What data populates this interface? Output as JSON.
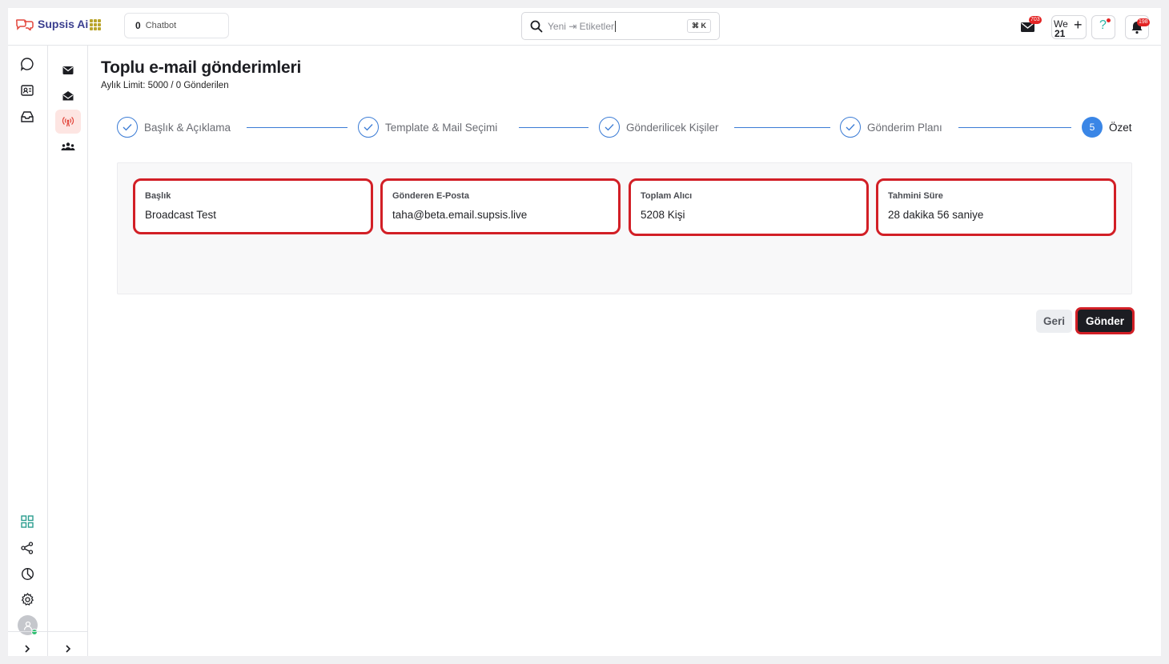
{
  "app": {
    "brand": "Supsis Ai"
  },
  "topbar": {
    "chatbot_count": "0",
    "chatbot_label": "Chatbot",
    "search_placeholder": "Yeni ⇥ Etiketler",
    "search_shortcut": "⌘ K",
    "mail_badge": "703",
    "calendar_day": "We",
    "calendar_date": "21",
    "help_icon": "?",
    "notification_badge": "198"
  },
  "page": {
    "title": "Toplu e-mail gönderimleri",
    "subtitle": "Aylık Limit: 5000 / 0 Gönderilen"
  },
  "stepper": {
    "steps": [
      {
        "label": "Başlık & Açıklama",
        "state": "done"
      },
      {
        "label": "Template & Mail Seçimi",
        "state": "done"
      },
      {
        "label": "Gönderilicek Kişiler",
        "state": "done"
      },
      {
        "label": "Gönderim Planı",
        "state": "done"
      },
      {
        "label": "Özet",
        "number": "5",
        "state": "current"
      }
    ]
  },
  "summary": {
    "cards": [
      {
        "label": "Başlık",
        "value": "Broadcast Test"
      },
      {
        "label": "Gönderen E-Posta",
        "value": "taha@beta.email.supsis.live"
      },
      {
        "label": "Toplam Alıcı",
        "value": "5208 Kişi"
      },
      {
        "label": "Tahmini Süre",
        "value": "28 dakika 56 saniye"
      }
    ]
  },
  "actions": {
    "back_label": "Geri",
    "send_label": "Gönder"
  },
  "colors": {
    "highlight": "#d21f26",
    "accent_blue": "#3a86e6",
    "brand": "#3b3f8f",
    "active_rail": "#fde5e2"
  }
}
